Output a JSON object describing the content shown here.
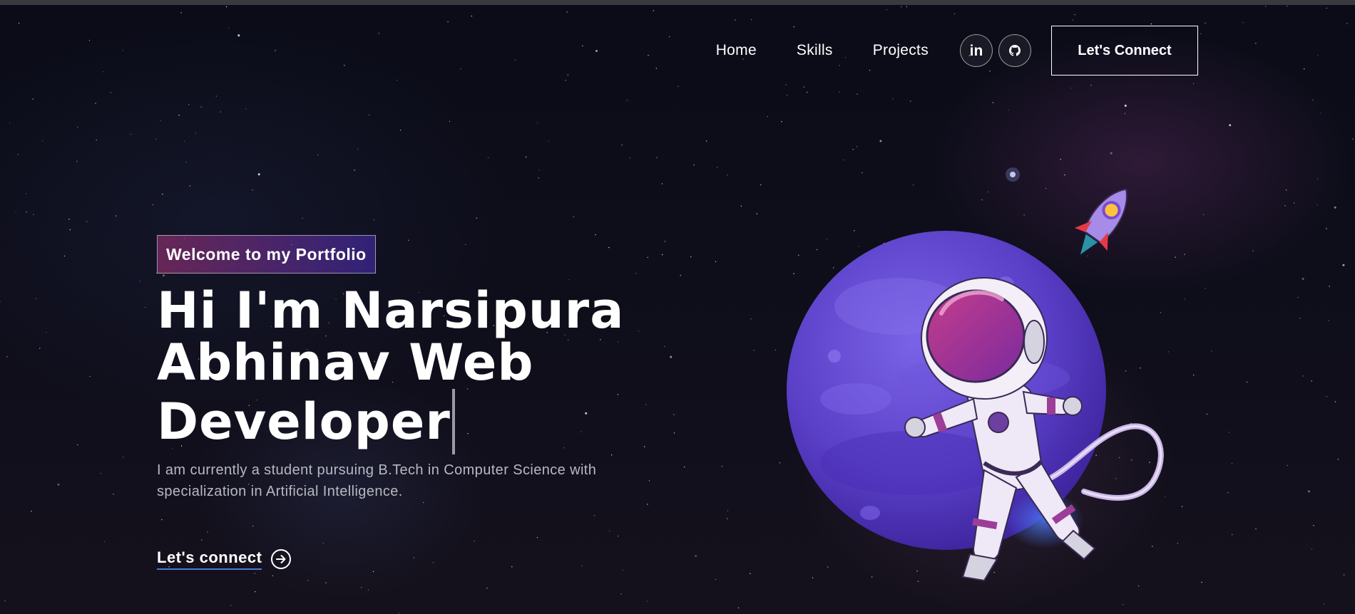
{
  "nav": {
    "links": [
      {
        "label": "Home"
      },
      {
        "label": "Skills"
      },
      {
        "label": "Projects"
      }
    ],
    "social": [
      {
        "name": "linkedin",
        "glyph": "in",
        "icon": "linkedin-icon"
      },
      {
        "name": "github",
        "icon": "github-icon"
      }
    ],
    "connect_button": "Let's Connect"
  },
  "hero": {
    "tagline": "Welcome to my Portfolio",
    "headline_lines": [
      "Hi I'm Narsipura",
      "Abhinav Web",
      "Developer"
    ],
    "description": "I am currently a student pursuing B.Tech in Computer Science with specialization in Artificial Intelligence.",
    "cta_label": "Let's connect",
    "cta_icon": "arrow-circle-right-icon"
  },
  "illustration": {
    "subject": "astronaut-planet-rocket-illustration"
  },
  "colors": {
    "background": "#0a0b14",
    "tag_gradient_start": "#aa367c",
    "tag_gradient_end": "#4a2fbd",
    "planet": "#6a4fd0",
    "link_underline": "#4b7bd8"
  }
}
